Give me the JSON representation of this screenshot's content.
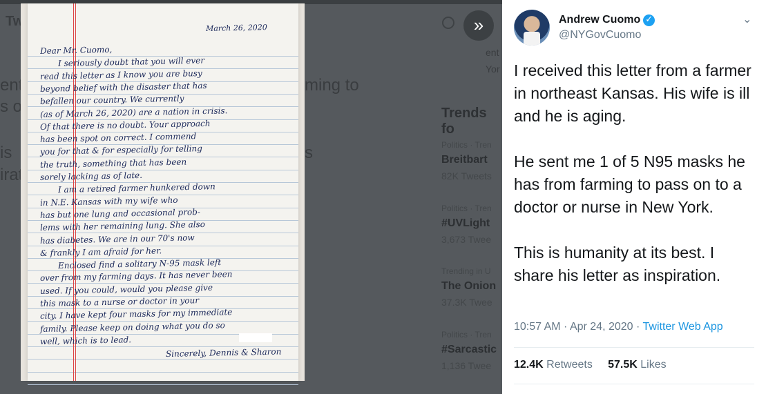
{
  "background": {
    "left_fragments": [
      "Tw",
      "ent",
      "s on",
      "is",
      "irat"
    ],
    "mid_fragments": [
      "ming to",
      "s"
    ],
    "right_fragments": [
      "ent",
      "Yor"
    ]
  },
  "trends": {
    "heading": "Trends fo",
    "items": [
      {
        "meta": "Politics · Tren",
        "name": "Breitbart",
        "count": "82K Tweets"
      },
      {
        "meta": "Politics · Tren",
        "name": "#UVLight",
        "count": "3,673 Twee"
      },
      {
        "meta": "Trending in U",
        "name": "The Onion",
        "count": "37.3K Twee"
      },
      {
        "meta": "Politics · Tren",
        "name": "#Sarcastic",
        "count": "1,136 Twee"
      }
    ]
  },
  "expand_icon_glyph": "»",
  "letter": {
    "date": "March 26, 2020",
    "lines": [
      "Dear Mr. Cuomo,",
      "I seriously doubt that you will ever",
      "read this letter as I know you are busy",
      "beyond belief with the disaster that has",
      "befallen our country. We currently",
      "(as of March 26, 2020) are a nation in crisis.",
      "Of that there is no doubt. Your approach",
      "has been spot on correct. I commend",
      "you for that & for especially for telling",
      "the truth, something that has been",
      "sorely lacking as of late.",
      "I am a retired farmer hunkered down",
      "in N.E. Kansas with my wife who",
      "has but one lung and occasional prob-",
      "lems with her remaining lung. She also",
      "has diabetes. We are in our 70's now",
      "& frankly I am afraid for her.",
      "Enclosed find a solitary N-95 mask left",
      "over from my farming days. It has never been",
      "used. If you could, would you please give",
      "this mask to a nurse or doctor in your",
      "city. I have kept four masks for my immediate",
      "family. Please keep on doing what you do so",
      "well, which is to lead.",
      "Sincerely, Dennis & Sharon"
    ]
  },
  "tweet": {
    "name": "Andrew Cuomo",
    "handle": "@NYGovCuomo",
    "more_icon": "⌄",
    "text": "I received this letter from a farmer in northeast Kansas. His wife is ill and he is aging.\n\nHe sent me 1 of 5 N95 masks he has from farming to pass on to a doctor or nurse in New York.\n\nThis is humanity at its best. I share his letter as inspiration.",
    "time": "10:57 AM · Apr 24, 2020 · ",
    "app": "Twitter Web App",
    "retweets_count": "12.4K",
    "retweets_label": "Retweets",
    "likes_count": "57.5K",
    "likes_label": "Likes"
  },
  "colors": {
    "accent": "#1da1f2",
    "link": "#1b95e0",
    "ink": "#1d2a5b"
  }
}
